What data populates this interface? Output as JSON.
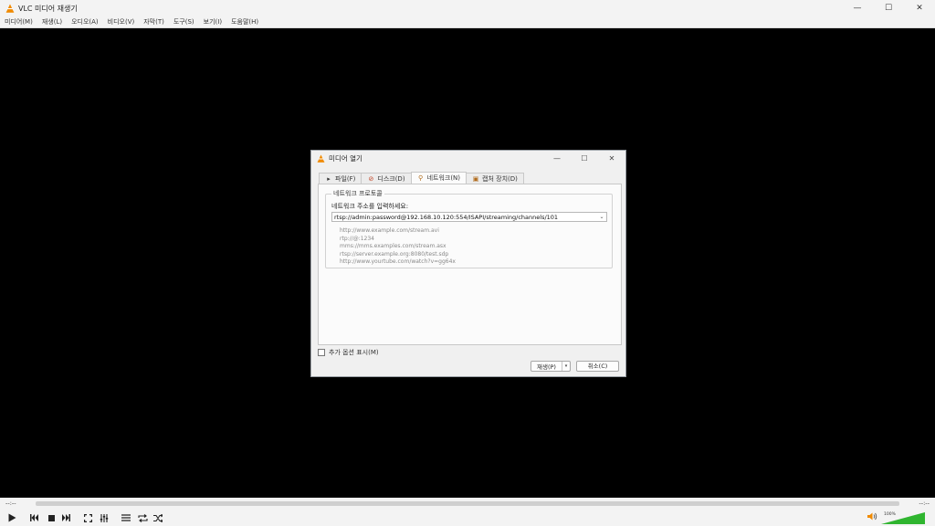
{
  "window": {
    "title": "VLC 미디어 재생기"
  },
  "window_buttons": {
    "minimize": "—",
    "maximize": "☐",
    "close": "✕"
  },
  "menu": [
    "미디어(M)",
    "재생(L)",
    "오디오(A)",
    "비디오(V)",
    "자막(T)",
    "도구(S)",
    "보기(I)",
    "도움말(H)"
  ],
  "dialog": {
    "title": "미디어 열기",
    "tabs": [
      {
        "label": "파일(F)",
        "icon": "file-icon"
      },
      {
        "label": "디스크(D)",
        "icon": "disc-icon"
      },
      {
        "label": "네트워크(N)",
        "icon": "network-icon"
      },
      {
        "label": "캡처 장치(D)",
        "icon": "capture-device-icon"
      }
    ],
    "active_tab": "네트워크(N)",
    "group_title": "네트워크 프로토콜",
    "url_label": "네트워크 주소를 입력하세요:",
    "url_value": "rtsp://admin:password@192.168.10.120:554/ISAPI/streaming/channels/101",
    "examples": [
      "http://www.example.com/stream.avi",
      "rtp://@:1234",
      "mms://mms.examples.com/stream.asx",
      "rtsp://server.example.org:8080/test.sdp",
      "http://www.yourtube.com/watch?v=gg64x"
    ],
    "more_options": "추가 옵션 표시(M)",
    "play_button": "재생(P)",
    "play_dropdown": "▾",
    "cancel_button": "취소(C)"
  },
  "player": {
    "time_elapsed": "--:--",
    "time_total": "--:--",
    "volume_percent": "100%"
  },
  "colors": {
    "accent_orange": "#f08a00",
    "volume_green": "#2fb52f",
    "background": "#000000",
    "chrome": "#f3f3f3"
  }
}
